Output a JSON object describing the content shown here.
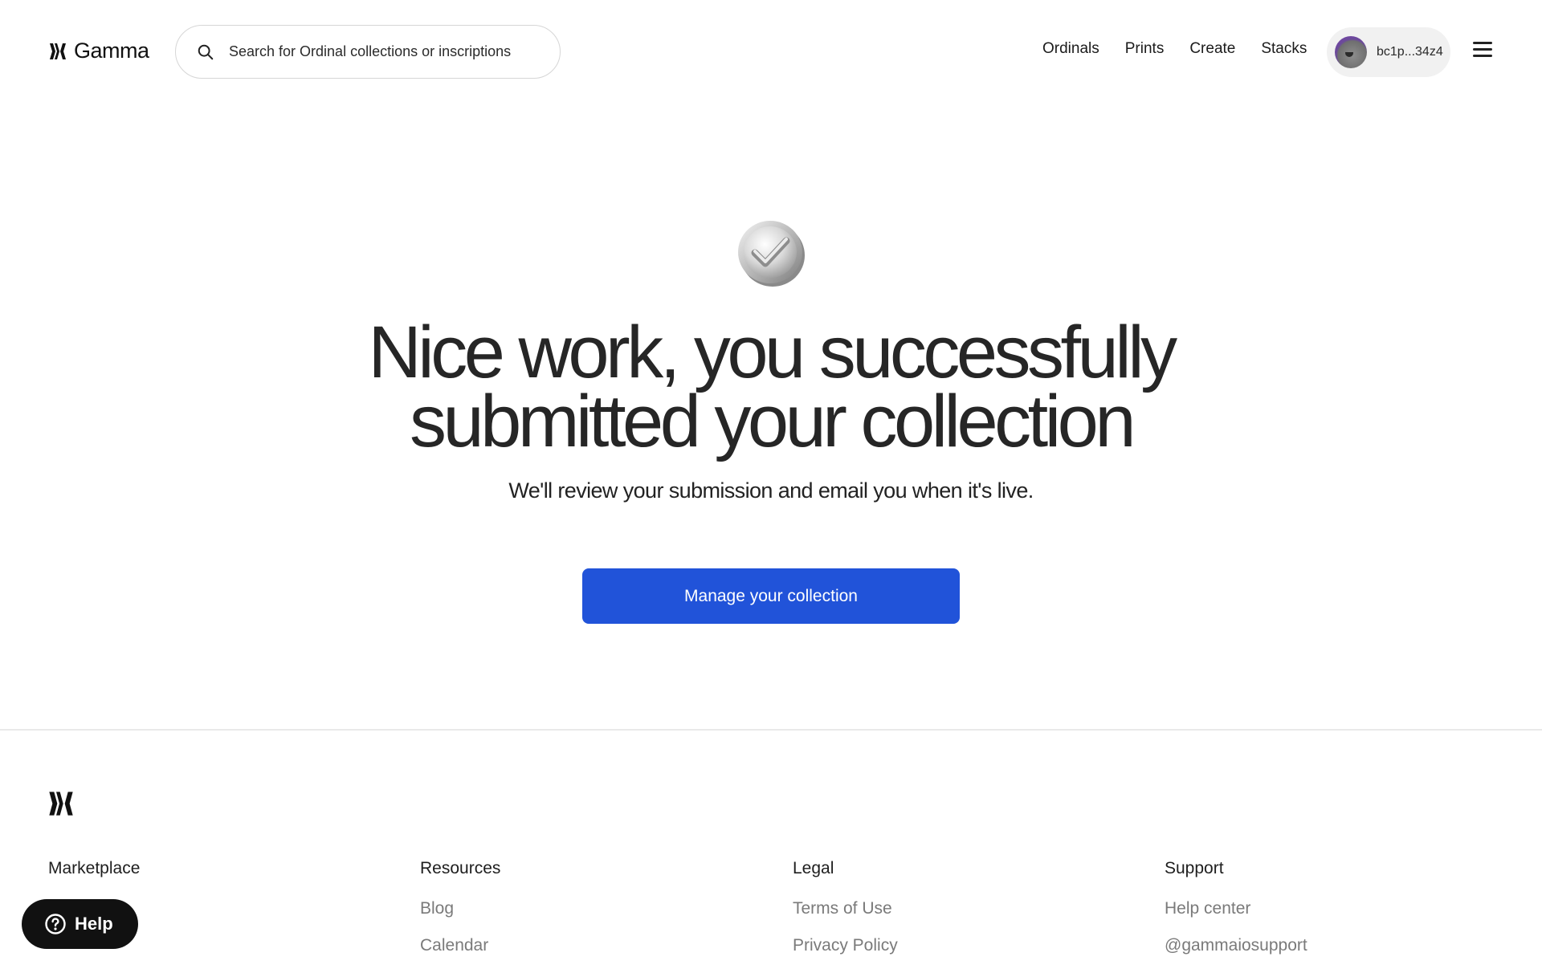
{
  "header": {
    "brand": "Gamma",
    "search_placeholder": "Search for Ordinal collections or inscriptions",
    "nav": [
      {
        "label": "Ordinals"
      },
      {
        "label": "Prints"
      },
      {
        "label": "Create"
      },
      {
        "label": "Stacks"
      }
    ],
    "wallet_address": "bc1p...34z4"
  },
  "hero": {
    "headline": "Nice work, you successfully submitted your collection",
    "subline": "We'll review your submission and email you when it's live.",
    "cta_label": "Manage your collection"
  },
  "footer": {
    "columns": [
      {
        "heading": "Marketplace",
        "links": []
      },
      {
        "heading": "Resources",
        "links": [
          "Blog",
          "Calendar"
        ]
      },
      {
        "heading": "Legal",
        "links": [
          "Terms of Use",
          "Privacy Policy"
        ]
      },
      {
        "heading": "Support",
        "links": [
          "Help center",
          "@gammaiosupport"
        ]
      }
    ]
  },
  "help_button": {
    "label": "Help"
  },
  "colors": {
    "accent": "#2153d9",
    "help_bg": "#111111",
    "wallet_bg": "#f1f1f1"
  },
  "icons": {
    "search": "search-icon",
    "menu": "menu-icon",
    "success": "check-badge-icon",
    "help": "question-icon"
  }
}
